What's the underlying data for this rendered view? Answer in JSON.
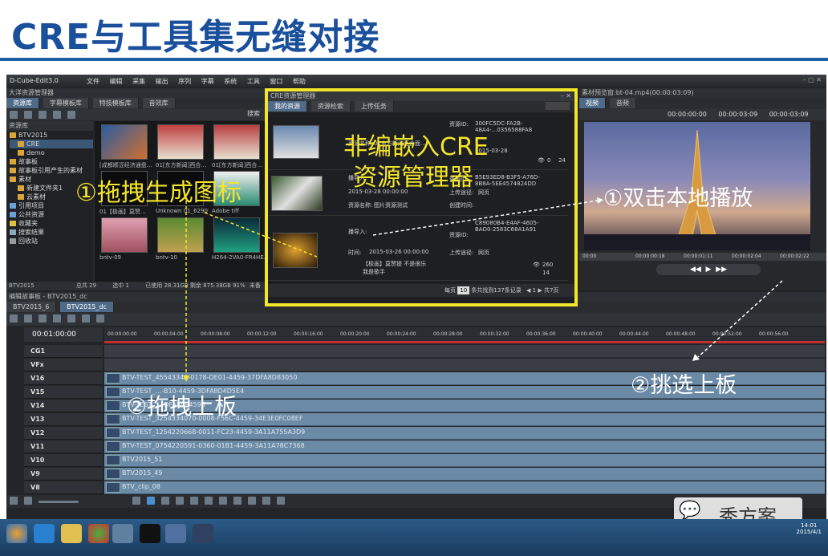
{
  "slide": {
    "title": "CRE与工具集无缝对接"
  },
  "app": {
    "title": "D-Cube-Edit3.0",
    "menu": [
      "文件",
      "编辑",
      "采集",
      "输出",
      "序列",
      "字幕",
      "系统",
      "工具",
      "窗口",
      "帮助"
    ],
    "resource_manager_title": "大洋资源管理器",
    "resource_tabs": [
      "资源库",
      "字幕模板库",
      "特技模板库",
      "音效库"
    ],
    "tree_header": "资源库",
    "tree": [
      "BTV2015",
      "CRE",
      "demo",
      "故事板",
      "故事板引用产生的素材",
      "素材",
      "新建文件夹1",
      "云素材",
      "引用项目",
      "公共资源",
      "收藏夹",
      "搜索结果",
      "回收站"
    ],
    "thumbs": [
      "[成都顺涩经济通盘…",
      "01[东方新闻]西合…",
      "01[东方新闻]西合…",
      "H264",
      "01【极画】莫赞…",
      "Unknown 01_62907.mp4",
      "Adobe tiff",
      "bntv-09",
      "bntv-10",
      "H264-2VA0-FR4HE…"
    ],
    "status_left": "BTV2015",
    "status_total": "总共 29",
    "status_selected": "选中 1",
    "status_disk": "已使用 28.31GB 剩余 875.38GB 91%",
    "status_more": "未备",
    "search_label": "搜索"
  },
  "cre": {
    "title": "CRE资源管理器",
    "tabs": [
      "我的资源",
      "资源检索",
      "上传任务"
    ],
    "items": [
      {
        "id_label": "资源ID:",
        "id_value": "300FC5DC-FA2B-48A4-...0356588FA8",
        "name_label": "资源名称:",
        "name_value": "01东方新闻西合面…",
        "time_label": "",
        "time_value": "2015-03-28",
        "count": "0",
        "num": "24"
      },
      {
        "id_label": "资源ID:",
        "id_value": "B5E93ED8-B3F5-A76D-8B8A-5EE4574824DD",
        "name_label": "资源名称:",
        "name_value": "图片资源测试",
        "time_label": "创建时间:",
        "time_value": "2015-03-28 00:00:00",
        "extra_label": "播导入:",
        "upload_label": "上传途径:",
        "upload_value": "网页"
      },
      {
        "id_label": "资源ID:",
        "id_value": "C89080B4-E4AF-4605-BAD0-2583C68A1A91",
        "name_label": "",
        "name_value": "【极画】莫赞提 不是很乐 我是歌手",
        "time_label": "时间:",
        "time_value": "2015-03-26 00:00:00",
        "upload_label": "上传途径:",
        "upload_value": "网页",
        "count": "260",
        "num": "14",
        "extra_label": "播导入:"
      }
    ],
    "pager_label": "每页",
    "pager_size": "10",
    "pager_total": "条共找到137条记录",
    "pager_page": "1",
    "pager_pages": "共7页"
  },
  "viewer": {
    "title": "素材预览窗:bt-04.mp4(00:00:03:09)",
    "tabs": [
      "视频",
      "音频"
    ],
    "tc1": "00:00:00:00",
    "tc2": "00:00:03:09",
    "tc3": "00:00:03:09",
    "ruler": [
      "00:00",
      "00:00:00:18",
      "00:00:01:11",
      "00:00:02:04",
      "00:00:02:22"
    ]
  },
  "timeline": {
    "header": "编辑故事板 - BTV2015_dc",
    "tabs": [
      "BTV2015_6",
      "BTV2015_dc"
    ],
    "timecode": "00:01:00:00",
    "ruler": [
      "00:00:00:00",
      "00:00:04:00",
      "00:00:08:00",
      "00:00:12:00",
      "00:00:16:00",
      "00:00:20:00",
      "00:00:24:00",
      "00:00:28:00",
      "00:00:32:00",
      "00:00:36:00",
      "00:00:40:00",
      "00:00:44:00",
      "00:00:48:00",
      "00:00:52:00",
      "00:00:56:00"
    ],
    "tracks": [
      {
        "name": "CG1",
        "clip": "",
        "empty": true
      },
      {
        "name": "VFx",
        "clip": "",
        "empty": true
      },
      {
        "name": "V16",
        "clip": "BTV-TEST_4554334A-0178-DE01-4459-37DFA8D83050"
      },
      {
        "name": "V15",
        "clip": "BTV-TEST_…-B10-4459-3DFA8D4D5E4"
      },
      {
        "name": "V14",
        "clip": "BTV-TEST_…-DFA8A94593"
      },
      {
        "name": "V13",
        "clip": "BTV-TEST_3254334070-0008-F56C-4459-34E3E0FC08EF"
      },
      {
        "name": "V12",
        "clip": "BTV-TEST_1254220668-0011-FC23-4459-3A11A755A3D9"
      },
      {
        "name": "V11",
        "clip": "BTV-TEST_0754220591-0360-01B1-4459-3A11A78C7368"
      },
      {
        "name": "V10",
        "clip": "BTV2015_51"
      },
      {
        "name": "V9",
        "clip": "BTV2015_49"
      },
      {
        "name": "V8",
        "clip": "BTV_clip_08"
      }
    ]
  },
  "callouts": {
    "cre_label_1": "非编嵌入CRE",
    "cre_label_2": "资源管理器",
    "drag_icon": "①拖拽生成图标",
    "double_click": "①双击本地播放",
    "drag_board": "②拖拽上板",
    "pick_board": "②挑选上板"
  },
  "watermark": {
    "text": "秀方案"
  },
  "clock": {
    "time": "14:01",
    "date": "2015/4/1"
  },
  "colors": {
    "title_blue": "#1a4f9c",
    "highlight_yellow": "#f3e52a",
    "clip_blue": "#6b8aa6"
  }
}
